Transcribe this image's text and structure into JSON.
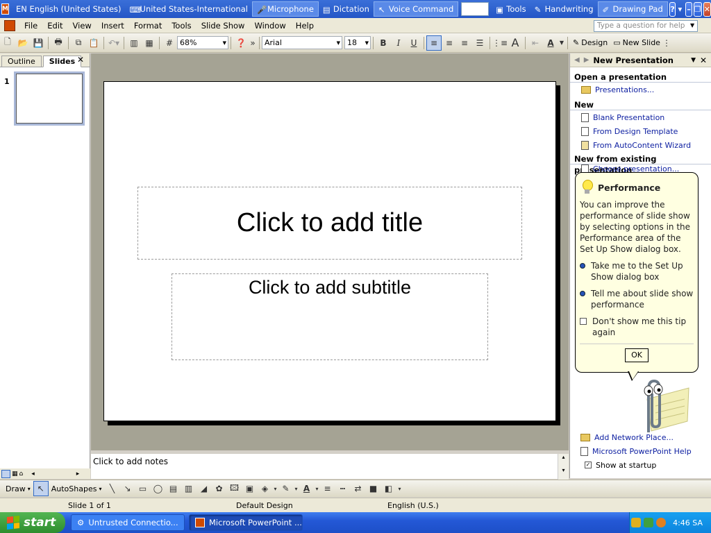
{
  "langbar": {
    "app_icon": "powerpoint-app-icon",
    "app_letter": "M",
    "items": [
      {
        "label": "EN English (United States)",
        "icon": "",
        "active": false
      },
      {
        "label": "United States-International",
        "icon": "keyboard-icon",
        "active": false
      },
      {
        "label": "Microphone",
        "icon": "microphone-icon",
        "active": true
      },
      {
        "label": "Dictation",
        "icon": "dictation-icon",
        "active": false
      },
      {
        "label": "Voice Command",
        "icon": "voice-command-icon",
        "active": true
      },
      {
        "label": "Tools",
        "icon": "tools-icon",
        "active": false
      },
      {
        "label": "Handwriting",
        "icon": "handwriting-icon",
        "active": false
      },
      {
        "label": "Drawing Pad",
        "icon": "drawing-pad-icon",
        "active": true
      }
    ]
  },
  "menubar": {
    "items": [
      "File",
      "Edit",
      "View",
      "Insert",
      "Format",
      "Tools",
      "Slide Show",
      "Window",
      "Help"
    ],
    "help_placeholder": "Type a question for help"
  },
  "toolbar": {
    "zoom": "68%",
    "font": "Arial",
    "font_size": "18",
    "bold": "B",
    "italic": "I",
    "underline": "U",
    "design_label": "Design",
    "new_slide_label": "New Slide"
  },
  "leftpane": {
    "tabs": [
      "Outline",
      "Slides"
    ],
    "active_tab": "Slides",
    "close": "✕",
    "slide_number": "1"
  },
  "slide": {
    "title_placeholder": "Click to add title",
    "subtitle_placeholder": "Click to add subtitle"
  },
  "notes": {
    "placeholder": "Click to add notes"
  },
  "taskpane": {
    "title": "New Presentation",
    "sections": {
      "open": "Open a presentation",
      "new": "New",
      "existing": "New from existing presentation"
    },
    "links": {
      "presentations": "Presentations...",
      "blank": "Blank Presentation",
      "design_template": "From Design Template",
      "autocontent": "From AutoContent Wizard",
      "choose": "Choose presentation...",
      "add_network": "Add Network Place...",
      "help": "Microsoft PowerPoint Help",
      "show_startup": "Show at startup"
    }
  },
  "balloon": {
    "title": "Performance",
    "body": "You can improve the performance of slide show by selecting options in the Performance area of the Set Up Show dialog box.",
    "option1": "Take me to the Set Up Show dialog box",
    "option2": "Tell me about slide show performance",
    "option3": "Don't show me this tip again",
    "ok": "OK"
  },
  "drawbar": {
    "draw": "Draw",
    "autoshapes": "AutoShapes"
  },
  "status": {
    "slide": "Slide 1 of 1",
    "design": "Default Design",
    "language": "English (U.S.)"
  },
  "taskbar": {
    "start": "start",
    "tasks": [
      "Untrusted Connectio...",
      "Microsoft PowerPoint ..."
    ],
    "clock": "4:46 SA"
  },
  "colors": {
    "taskbar": "#245edb",
    "start": "#3c9a3c",
    "link": "#0b1da0",
    "balloon": "#ffffe1"
  }
}
